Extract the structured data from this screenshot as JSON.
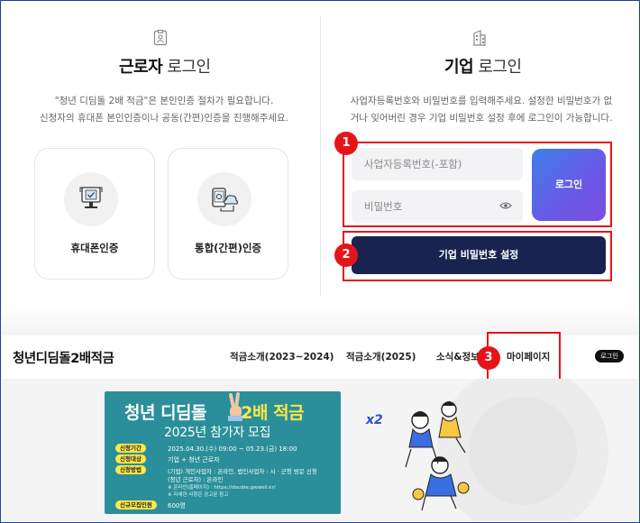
{
  "worker_login": {
    "title_bold": "근로자",
    "title_rest": "로그인",
    "desc_line1": "\"청년 디딤돌 2배 적금\"은 본인인증 절차가 필요합니다.",
    "desc_line2": "신청자의 휴대폰 본인인증이나 공동(간편)인증을 진행해주세요.",
    "option_phone": "휴대폰인증",
    "option_cert": "통합(간편)인증"
  },
  "company_login": {
    "title_bold": "기업",
    "title_rest": "로그인",
    "desc_line1": "사업자등록번호와 비밀번호를 입력해주세요. 설정한 비밀번호가 없",
    "desc_line2": "거나 잊어버린 경우 기업 비밀번호 설정 후에 로그인이 가능합니다.",
    "bizno_placeholder": "사업자등록번호(-포함)",
    "password_placeholder": "비밀번호",
    "login_button": "로그인",
    "set_password_button": "기업 비밀번호 설정"
  },
  "callouts": [
    "1",
    "2",
    "3"
  ],
  "nav": {
    "brand": "청년디딤돌2배적금",
    "items": [
      "적금소개(2023~2024)",
      "적금소개(2025)",
      "소식&정보",
      "마이페이지"
    ],
    "login": "로그인"
  },
  "banner": {
    "title_a": "청년 디딤돌",
    "title_b": "2배 적금",
    "subtitle": "2025년 참가자 모집",
    "rows": [
      {
        "tag": "신청기간",
        "text": "2025.04.30.(수) 09:00 ~ 05.23.(금) 18:00"
      },
      {
        "tag": "신청대상",
        "text": "기업 + 청년 근로자"
      },
      {
        "tag": "신청방법",
        "text": "(기업) 개인사업자 : 온라인, 법인사업자 : 시 · 군청 방문 신청"
      }
    ],
    "method_line2": "(청년 근로자) : 온라인",
    "note1": "※ 온라인(홈페이지) : https://double.gwwell.kr/",
    "note2": "※ 자세한 사항은 공고문 참고",
    "quota_tag": "신규모집인원",
    "quota": "600명",
    "x2": "x2"
  },
  "colors": {
    "highlight": "#e5141b",
    "primary_dark": "#18244f",
    "login_gradient_start": "#3f7fe8",
    "login_gradient_end": "#7a4fe0",
    "banner_teal": "#2a8f9a"
  }
}
